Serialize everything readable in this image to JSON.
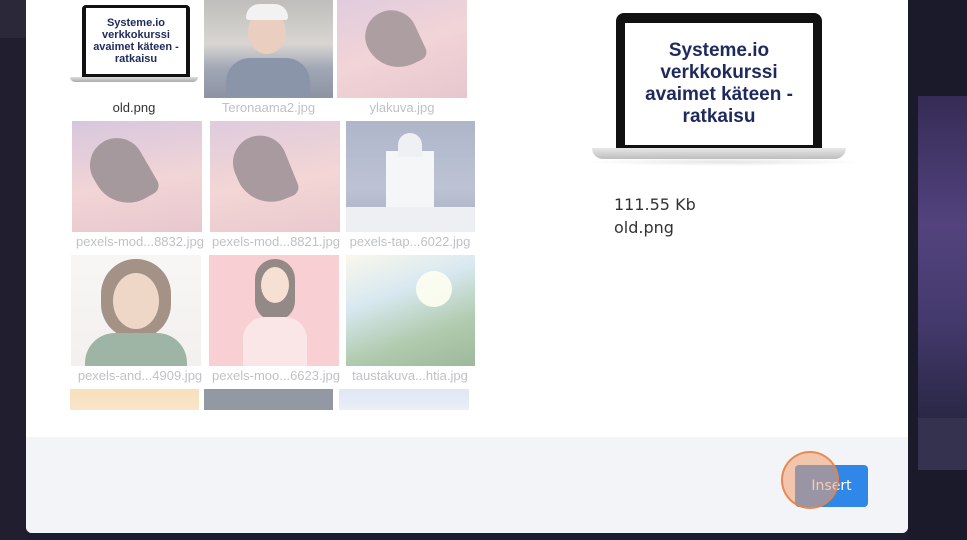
{
  "files": [
    {
      "caption": "old.png",
      "selected": true
    },
    {
      "caption": "Teronaama2.jpg"
    },
    {
      "caption": "ylakuva.jpg"
    },
    {
      "caption": "pexels-mod...8832.jpg"
    },
    {
      "caption": "pexels-mod...8821.jpg"
    },
    {
      "caption": "pexels-tap...6022.jpg"
    },
    {
      "caption": "pexels-and...4909.jpg"
    },
    {
      "caption": "pexels-moo...6623.jpg"
    },
    {
      "caption": "taustakuva...htia.jpg"
    }
  ],
  "thumb_logo": {
    "line1": "Systeme.io",
    "line2": "verkkokurssi",
    "line3": "avaimet käteen -",
    "line4": "ratkaisu"
  },
  "preview": {
    "logo": {
      "line1": "Systeme.io",
      "line2": "verkkokurssi",
      "line3": "avaimet käteen -",
      "line4": "ratkaisu"
    },
    "file_size": "111.55 Kb",
    "file_name": "old.png"
  },
  "footer": {
    "insert_label": "Insert"
  },
  "colors": {
    "accent": "#2f88e8",
    "click_marker": "#f0a06e"
  }
}
